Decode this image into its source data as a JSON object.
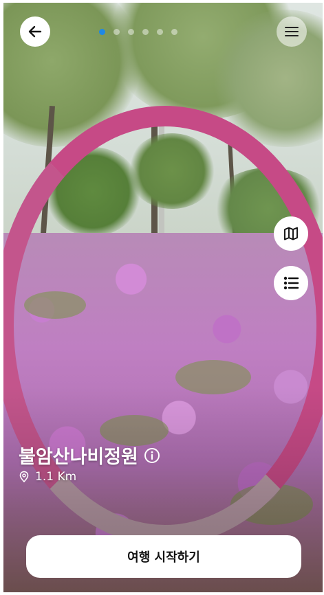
{
  "header": {
    "back_icon": "arrow-left-icon",
    "menu_icon": "hamburger-menu-icon",
    "carousel": {
      "count": 6,
      "active_index": 0,
      "active_color": "#1e88e5"
    }
  },
  "side_actions": {
    "map_icon": "map-icon",
    "list_icon": "list-icon"
  },
  "place": {
    "name": "불암산나비정원",
    "info_icon": "info-icon",
    "location_icon": "location-pin-icon",
    "distance": "1.1 Km"
  },
  "footer": {
    "start_label": "여행 시작하기"
  }
}
